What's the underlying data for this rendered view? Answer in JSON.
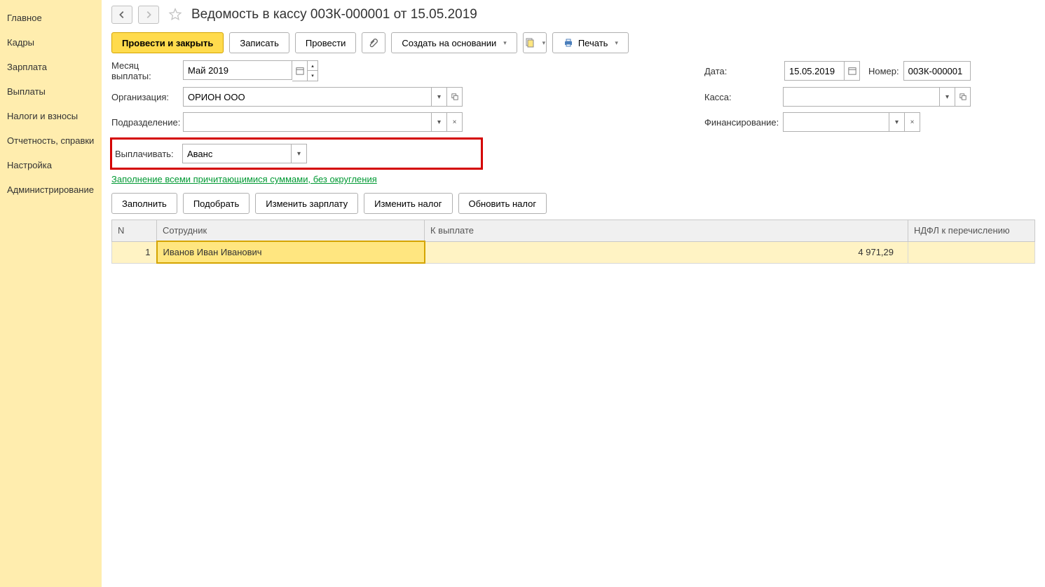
{
  "sidebar": {
    "items": [
      {
        "label": "Главное"
      },
      {
        "label": "Кадры"
      },
      {
        "label": "Зарплата"
      },
      {
        "label": "Выплаты"
      },
      {
        "label": "Налоги и взносы"
      },
      {
        "label": "Отчетность, справки"
      },
      {
        "label": "Настройка"
      },
      {
        "label": "Администрирование"
      }
    ]
  },
  "header": {
    "title": "Ведомость в кассу 00ЗК-000001 от 15.05.2019"
  },
  "toolbar": {
    "post_close": "Провести и закрыть",
    "write": "Записать",
    "post": "Провести",
    "create_based": "Создать на основании",
    "print": "Печать"
  },
  "form": {
    "month_label": "Месяц выплаты:",
    "month_value": "Май 2019",
    "org_label": "Организация:",
    "org_value": "ОРИОН ООО",
    "dept_label": "Подразделение:",
    "dept_value": "",
    "pay_label": "Выплачивать:",
    "pay_value": "Аванс",
    "date_label": "Дата:",
    "date_value": "15.05.2019",
    "number_label": "Номер:",
    "number_value": "00ЗК-000001",
    "kassa_label": "Касса:",
    "kassa_value": "",
    "finance_label": "Финансирование:",
    "finance_value": "",
    "link_text": "Заполнение всеми причитающимися суммами, без округления"
  },
  "table_toolbar": {
    "fill": "Заполнить",
    "pick": "Подобрать",
    "edit_salary": "Изменить зарплату",
    "edit_tax": "Изменить налог",
    "update_tax": "Обновить налог"
  },
  "table": {
    "headers": {
      "n": "N",
      "employee": "Сотрудник",
      "to_pay": "К выплате",
      "ndfl": "НДФЛ к перечислению"
    },
    "rows": [
      {
        "n": "1",
        "employee": "Иванов Иван Иванович",
        "to_pay": "4 971,29",
        "ndfl": ""
      }
    ]
  }
}
